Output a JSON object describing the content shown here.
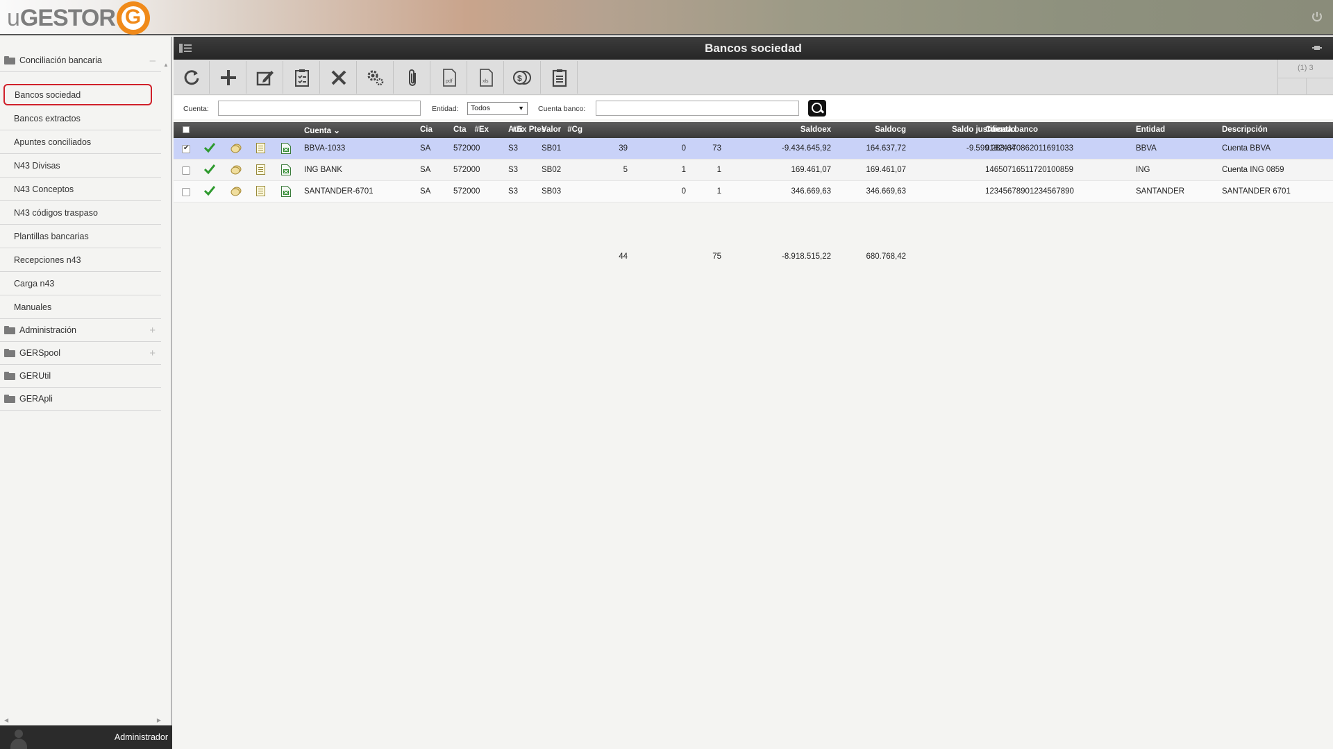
{
  "app": {
    "logo_text": "uGESTOR",
    "user_name": "Administrador"
  },
  "sidebar": {
    "groups": [
      {
        "label": "Conciliación bancaria",
        "toggle": "–"
      },
      {
        "label": "Administración",
        "toggle": "+"
      },
      {
        "label": "GERSpool",
        "toggle": "+"
      },
      {
        "label": "GERUtil",
        "toggle": ""
      },
      {
        "label": "GERApli",
        "toggle": ""
      }
    ],
    "items": [
      {
        "label": "Bancos sociedad",
        "active": true
      },
      {
        "label": "Bancos extractos"
      },
      {
        "label": "Apuntes conciliados"
      },
      {
        "label": "N43 Divisas"
      },
      {
        "label": "N43 Conceptos"
      },
      {
        "label": "N43 códigos traspaso"
      },
      {
        "label": "Plantillas bancarias"
      },
      {
        "label": "Recepciones n43"
      },
      {
        "label": "Carga n43"
      },
      {
        "label": "Manuales"
      }
    ]
  },
  "main": {
    "title": "Bancos sociedad",
    "pager": "(1) 3",
    "toolbar": [
      {
        "icon": "refresh-icon"
      },
      {
        "icon": "add-icon"
      },
      {
        "icon": "edit-icon"
      },
      {
        "icon": "checklist-icon"
      },
      {
        "icon": "delete-icon"
      },
      {
        "icon": "settings-icon"
      },
      {
        "icon": "attachment-icon"
      },
      {
        "icon": "pdf-icon"
      },
      {
        "icon": "xls-icon"
      },
      {
        "icon": "coins-icon"
      },
      {
        "icon": "clipboard-icon"
      }
    ],
    "filters": {
      "cuenta_label": "Cuenta:",
      "cuenta_value": "",
      "entidad_label": "Entidad:",
      "entidad_value": "Todos",
      "cuenta_banco_label": "Cuenta banco:",
      "cuenta_banco_value": ""
    },
    "columns": {
      "cuenta": "Cuenta",
      "sort_indicator": "⌄",
      "cia": "Cia",
      "cta": "Cta",
      "aux": "Aux",
      "valor": "Valor",
      "ex": "#Ex",
      "ex_ptes": "#Ex Ptes",
      "cg": "#Cg",
      "saldoex": "Saldoex",
      "saldocg": "Saldocg",
      "saldo_just": "Saldo justificado",
      "cuenta_banco": "Cuenta banco",
      "entidad": "Entidad",
      "descripcion": "Descripción"
    },
    "rows": [
      {
        "cuenta": "BBVA-1033",
        "cia": "SA",
        "cta": "572000",
        "aux": "S3",
        "valor": "SB01",
        "ex": "39",
        "ex_ptes": "0",
        "cg": "73",
        "saldoex": "-9.434.645,92",
        "saldocg": "164.637,72",
        "saldo_just": "-9.599.283,64",
        "cuenta_banco": "01824370862011691033",
        "entidad": "BBVA",
        "descripcion": "Cuenta BBVA",
        "checked": true
      },
      {
        "cuenta": "ING BANK",
        "cia": "SA",
        "cta": "572000",
        "aux": "S3",
        "valor": "SB02",
        "ex": "5",
        "ex_ptes": "1",
        "cg": "1",
        "saldoex": "169.461,07",
        "saldocg": "169.461,07",
        "saldo_just": "",
        "cuenta_banco": "14650716511720100859",
        "entidad": "ING",
        "descripcion": "Cuenta ING 0859",
        "checked": false
      },
      {
        "cuenta": "SANTANDER-6701",
        "cia": "SA",
        "cta": "572000",
        "aux": "S3",
        "valor": "SB03",
        "ex": "",
        "ex_ptes": "0",
        "cg": "1",
        "saldoex": "346.669,63",
        "saldocg": "346.669,63",
        "saldo_just": "",
        "cuenta_banco": "12345678901234567890",
        "entidad": "SANTANDER",
        "descripcion": "SANTANDER 6701",
        "checked": false
      }
    ],
    "totals": {
      "ex": "44",
      "cg": "75",
      "saldoex": "-8.918.515,22",
      "saldocg": "680.768,42"
    }
  }
}
